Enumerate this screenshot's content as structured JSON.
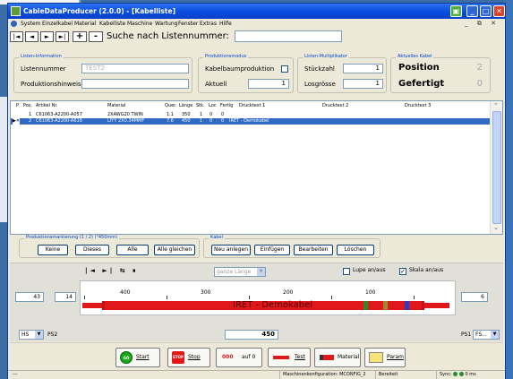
{
  "window": {
    "title": "CableDataProducer (2.0.0) - [Kabelliste]"
  },
  "menu": [
    "System",
    "Einzelkabel",
    "Material",
    "Kabelliste",
    "Maschine",
    "Wartung",
    "Fenster",
    "Extras",
    "Hilfe"
  ],
  "nav": {
    "buttons": [
      "|◄",
      "◄",
      "►",
      "►|",
      "+",
      "-"
    ],
    "search_label": "Suche nach Listennummer:",
    "search_value": ""
  },
  "listen_info": {
    "legend": "Listen-Information",
    "listennummer_label": "Listennummer",
    "listennummer_value": "TEST2",
    "produktionshinweis_label": "Produktionshinweis",
    "produktionshinweis_value": ""
  },
  "produktionsmodus": {
    "legend": "Produktionsmodus",
    "kabelbaum_label": "Kabelbaumproduktion",
    "kabelbaum_checked": false,
    "aktuell_label": "Aktuell",
    "aktuell_value": "1"
  },
  "multiplikator": {
    "legend": "Listen-Multiplikator",
    "stueckzahl_label": "Stückzahl",
    "stueckzahl_value": "1",
    "losgroesse_label": "Losgrösse",
    "losgroesse_value": "1"
  },
  "aktuelles_kabel": {
    "legend": "Aktuelles Kabel",
    "position_label": "Position",
    "position_value": "2",
    "gefertigt_label": "Gefertigt",
    "gefertigt_value": "0"
  },
  "table": {
    "headers": [
      "P",
      "Pos.",
      "Artikel Nr.",
      "Material",
      "Quer.",
      "Länge",
      "Stk.",
      "Loc",
      "Fertig",
      "Drucktext 1",
      "Drucktext 2",
      "Drucktext 3"
    ],
    "rows": [
      {
        "p": "",
        "pos": "1",
        "artikel": "C61063-A2200-A057",
        "material": "2XAWG20 TWIN",
        "quer": "1.1",
        "laenge": "350",
        "stk": "1",
        "loc": "0",
        "fertig": "0",
        "druck1": "",
        "druck2": "",
        "druck3": "",
        "selected": false
      },
      {
        "p": "▶✕",
        "pos": "2",
        "artikel": "C61063-A2200-A616",
        "material": "LIYY 2X0.34MMF",
        "quer": "7.6",
        "laenge": "450",
        "stk": "1",
        "loc": "0",
        "fertig": "0",
        "druck1": "IRET - Demokabel",
        "druck2": "",
        "druck3": "",
        "selected": true
      }
    ]
  },
  "markierung": {
    "legend": "Produktionsmarkierung (1 / 2) (\"450mm)",
    "buttons": [
      "Keine",
      "Dieses",
      "Alle",
      "Alle gleichen"
    ]
  },
  "kabel": {
    "legend": "Kabel",
    "buttons": [
      "Neu anlegen",
      "Einfügen",
      "Bearbeiten",
      "Löschen"
    ]
  },
  "cable_view": {
    "combo_value": "ganze Länge",
    "lupe_label": "Lupe an/aus",
    "lupe_checked": false,
    "skala_label": "Skala an/aus",
    "skala_checked": true,
    "left_outer": "43",
    "left_inner": "14",
    "right_inner": "6",
    "ticks": [
      "400",
      "300",
      "200",
      "100"
    ],
    "cable_text": "IRET - Demokabel",
    "length": "450",
    "left_combo": "HS",
    "left_label": "PS2",
    "right_label": "PS1",
    "right_combo": "FS...",
    "cable_color": "#e0181c"
  },
  "bottom": {
    "start": "Start",
    "stop": "Stop",
    "auf_null": "auf 0",
    "auf_null_icon": "000",
    "test": "Test",
    "material": "Material",
    "param": "Param",
    "go_icon": "GO",
    "stop_icon": "STOP"
  },
  "status": {
    "left": "---",
    "config": "Maschinenkonfiguration: MCONFIG_2",
    "state": "Bereiteit",
    "sync": "Sync:",
    "time": "0 ms"
  }
}
